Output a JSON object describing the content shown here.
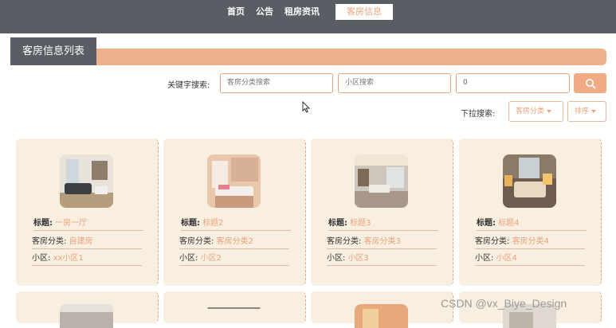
{
  "nav": {
    "items": [
      "首页",
      "公告",
      "租房资讯"
    ],
    "active": "客房信息"
  },
  "page_title": "客房信息列表",
  "search": {
    "keyword_label": "关键字搜索:",
    "category_placeholder": "客房分类搜索",
    "community_placeholder": "小区搜索",
    "third_value": "0"
  },
  "dropdown": {
    "label": "下拉搜索:",
    "category": "客房分类",
    "sort": "排序"
  },
  "cards": [
    {
      "title_key": "标题:",
      "title": "一房一厅",
      "cat_key": "客房分类:",
      "category": "自建房",
      "comm_key": "小区:",
      "community": "xx小区1"
    },
    {
      "title_key": "标题:",
      "title": "标题2",
      "cat_key": "客房分类:",
      "category": "客房分类2",
      "comm_key": "小区:",
      "community": "小区2"
    },
    {
      "title_key": "标题:",
      "title": "标题3",
      "cat_key": "客房分类:",
      "category": "客房分类3",
      "comm_key": "小区:",
      "community": "小区3"
    },
    {
      "title_key": "标题:",
      "title": "标题4",
      "cat_key": "客房分类:",
      "category": "客房分类4",
      "comm_key": "小区:",
      "community": "小区4"
    }
  ],
  "watermark": "CSDN @vx_Biye_Design",
  "colors": {
    "topbar": "#595d64",
    "accent": "#e9a27c",
    "card_bg": "#f8efe1",
    "title_bar": "#edb08b"
  }
}
